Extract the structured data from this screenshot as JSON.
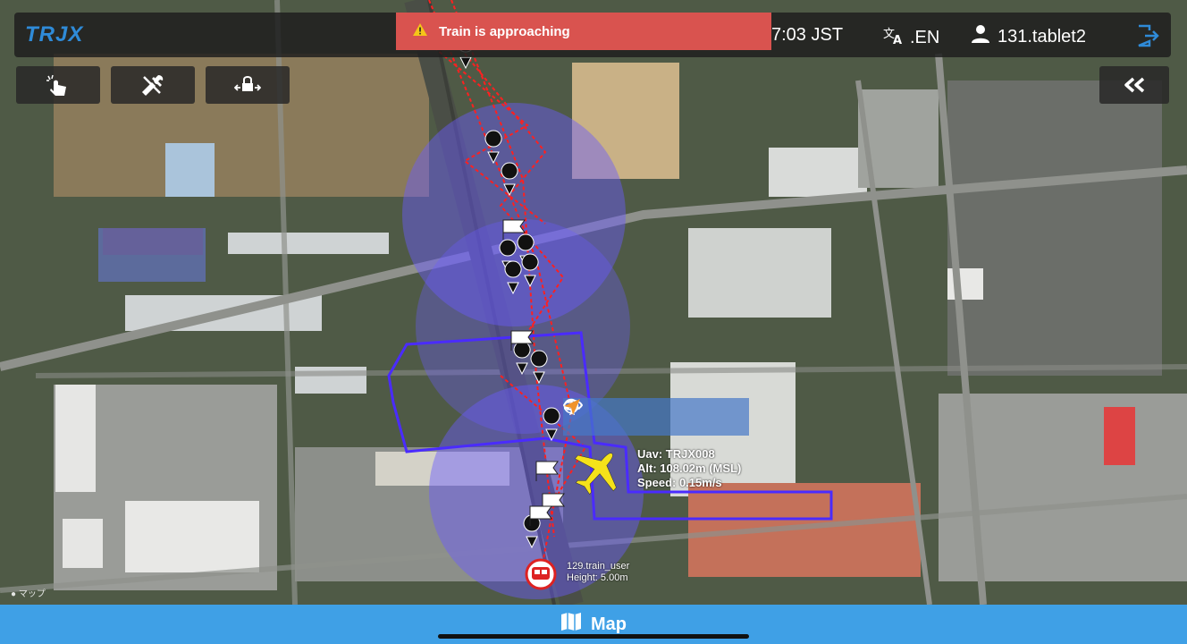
{
  "app": {
    "logo": "TRJX"
  },
  "header": {
    "clock": "7:03 JST",
    "lang_label": ".EN",
    "user_label": "131.tablet2"
  },
  "alert": {
    "text": "Train is approaching"
  },
  "map_popup": {
    "uav_line": "Uav: TRJX008",
    "alt_line": "Alt: 108.02m (MSL)",
    "speed_line": "Speed: 0.15m/s"
  },
  "train_marker": {
    "name": "129.train_user",
    "height": "Height: 5.00m"
  },
  "map_attribution": "マップ",
  "bottom_tab": {
    "label": "Map"
  },
  "colors": {
    "accent": "#3fa0e6",
    "alert": "#d9534f",
    "geofence": "#4a2bff",
    "route": "#ff2020",
    "uav": "#f5e21a"
  },
  "icons": [
    "warning-icon",
    "translate-icon",
    "user-icon",
    "logout-icon",
    "touch-icon",
    "tools-icon",
    "anchor-icon",
    "collapse-icon",
    "eye-icon",
    "globe-icon",
    "plane-icon",
    "send-icon",
    "map-icon"
  ]
}
